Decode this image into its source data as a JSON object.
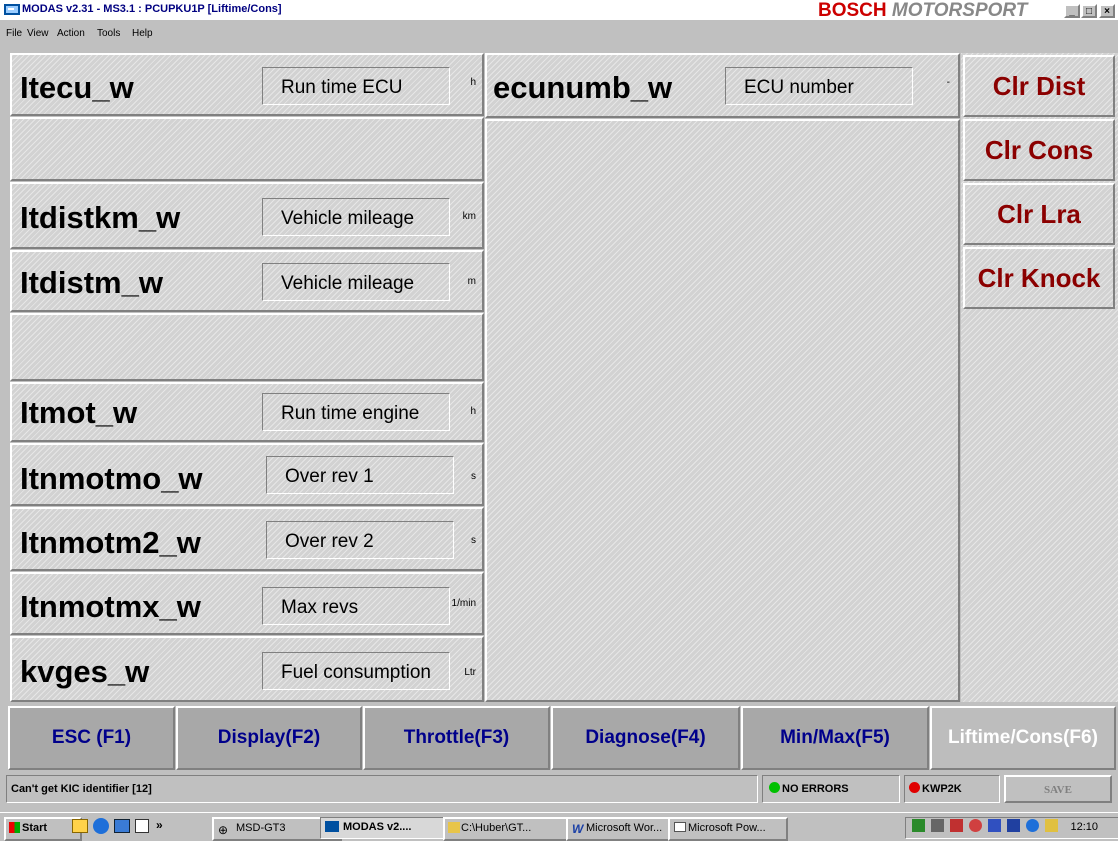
{
  "window": {
    "title": "MODAS v2.31 - MS3.1 : PCUPKU1P   [Liftime/Cons]",
    "brand_bosch": "BOSCH",
    "brand_motorsport": "MOTORSPORT"
  },
  "menu": [
    "File",
    "View",
    "Action",
    "Tools",
    "Help"
  ],
  "params_left": [
    {
      "name": "Itecu_w",
      "desc": "Run time ECU",
      "unit": "h"
    },
    {
      "name": "",
      "desc": "",
      "unit": ""
    },
    {
      "name": "Itdistkm_w",
      "desc": "Vehicle mileage",
      "unit": "km"
    },
    {
      "name": "Itdistm_w",
      "desc": "Vehicle mileage",
      "unit": "m"
    },
    {
      "name": "",
      "desc": "",
      "unit": ""
    },
    {
      "name": "Itmot_w",
      "desc": "Run time engine",
      "unit": "h"
    },
    {
      "name": "Itnmotmo_w",
      "desc": "Over rev 1",
      "unit": "s"
    },
    {
      "name": "Itnmotm2_w",
      "desc": "Over rev 2",
      "unit": "s"
    },
    {
      "name": "Itnmotmx_w",
      "desc": "Max revs",
      "unit": "1/min"
    },
    {
      "name": "kvges_w",
      "desc": "Fuel consumption",
      "unit": "Ltr"
    }
  ],
  "param_mid": {
    "name": "ecunumb_w",
    "desc": "ECU number",
    "unit": "-"
  },
  "clear_buttons": [
    "Clr Dist",
    "Clr Cons",
    "Clr Lra",
    "Clr Knock"
  ],
  "function_keys": [
    "ESC (F1)",
    "Display(F2)",
    "Throttle(F3)",
    "Diagnose(F4)",
    "Min/Max(F5)",
    "Liftime/Cons(F6)"
  ],
  "status": {
    "message": "Can't get KIC identifier [12]",
    "errors": "NO ERRORS",
    "protocol": "KWP2K",
    "save": "SAVE",
    "errors_color": "#00c000",
    "protocol_color": "#e00000"
  },
  "taskbar": {
    "start": "Start",
    "more": "»",
    "items": [
      "MSD-GT3",
      "MODAS v2....",
      "C:\\Huber\\GT...",
      "Microsoft Wor...",
      "Microsoft Pow..."
    ],
    "clock": "12:10"
  }
}
